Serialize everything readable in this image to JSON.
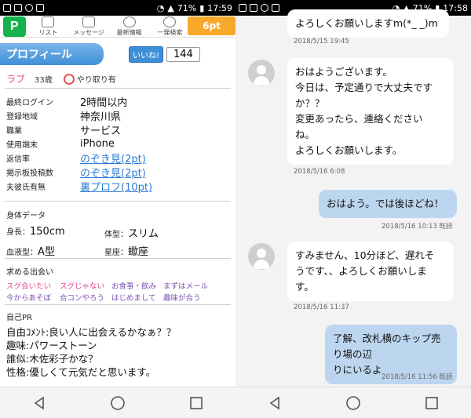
{
  "left": {
    "status": {
      "battery": "71%",
      "time": "17:59"
    },
    "nav": {
      "logo": "P",
      "tabs": [
        "リスト",
        "メッセージ",
        "最新情報",
        "一発検索"
      ],
      "points": "6pt"
    },
    "profile_header": "プロフィール",
    "iine": {
      "label": "いいね!",
      "count": "144"
    },
    "meta": {
      "love": "ラブ",
      "age": "33歳",
      "exchange": "やり取り有"
    },
    "info": [
      {
        "key": "最終ログイン",
        "value": "2時間以内",
        "link": false
      },
      {
        "key": "登録地域",
        "value": "神奈川県",
        "link": false
      },
      {
        "key": "職業",
        "value": "サービス",
        "link": false
      },
      {
        "key": "使用端末",
        "value": "iPhone",
        "link": false
      },
      {
        "key": "返信率",
        "value": "のぞき見(2pt)",
        "link": true
      },
      {
        "key": "掲示板投稿数",
        "value": "のぞき見(2pt)",
        "link": true
      },
      {
        "key": "夫彼氏有無",
        "value": "裏プロフ(10pt)",
        "link": true
      }
    ],
    "body": {
      "heading": "身体データ",
      "height": {
        "k": "身長：",
        "v": "150cm"
      },
      "figure": {
        "k": "体型：",
        "v": "スリム"
      },
      "blood": {
        "k": "血液型：",
        "v": "A型"
      },
      "sign": {
        "k": "星座：",
        "v": "蠍座"
      }
    },
    "seeking": {
      "heading": "求める出会い",
      "row1": [
        "スグ会いたい",
        "スグじゃない",
        "お食事・飲み",
        "まずはメール"
      ],
      "row2": [
        "今からあそぼ",
        "合コンやろう",
        "はじめまして",
        "趣味が合う"
      ]
    },
    "pr": {
      "heading": "自己PR",
      "lines": [
        "自由ｺﾒﾝﾄ:良い人に出会えるかなぁ？？",
        "趣味:パワーストーン",
        "誰似:木佐彩子かな？",
        "性格:優しくて元気だと思います。"
      ]
    }
  },
  "right": {
    "status": {
      "battery": "71%",
      "time": "17:58"
    },
    "messages": [
      {
        "side": "them",
        "text": [
          "よろしくお願いしますm(*_ _)m"
        ],
        "time": "2018/5/15 19:45"
      },
      {
        "side": "them",
        "text": [
          "おはようございます。",
          "今日は、予定通りで大丈夫です",
          "か？？",
          "変更あったら、連絡ください",
          "ね。",
          "よろしくお願いします。"
        ],
        "time": "2018/5/16 6:08"
      },
      {
        "side": "me",
        "text": [
          "おはよう。では後ほどね！"
        ],
        "time": "2018/5/16 10:13 既読"
      },
      {
        "side": "them",
        "text": [
          "すみません、10分ほど、遅れそ",
          "うです、、よろしくお願いしま",
          "す。"
        ],
        "time": "2018/5/16 11:37"
      },
      {
        "side": "me",
        "text": [
          "了解、改札横のキップ売り場の辺",
          "りにいるよ"
        ],
        "time": "2018/5/16 11:56 既読"
      }
    ]
  }
}
